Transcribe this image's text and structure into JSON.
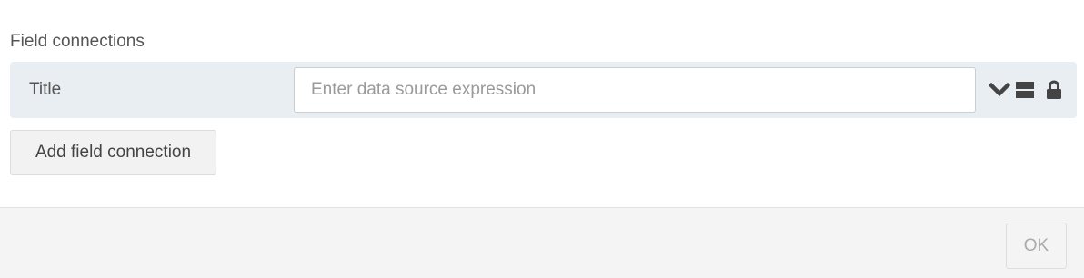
{
  "section": {
    "title": "Field connections"
  },
  "field_connections": [
    {
      "label": "Title",
      "expression_value": "",
      "expression_placeholder": "Enter data source expression",
      "icons": [
        "chevron-down-icon",
        "stack-icon",
        "lock-icon"
      ]
    }
  ],
  "actions": {
    "add_label": "Add field connection"
  },
  "footer": {
    "ok_label": "OK"
  },
  "colors": {
    "row_background": "#e8eef2",
    "footer_background": "#f4f4f4",
    "icon_color": "#444444"
  }
}
